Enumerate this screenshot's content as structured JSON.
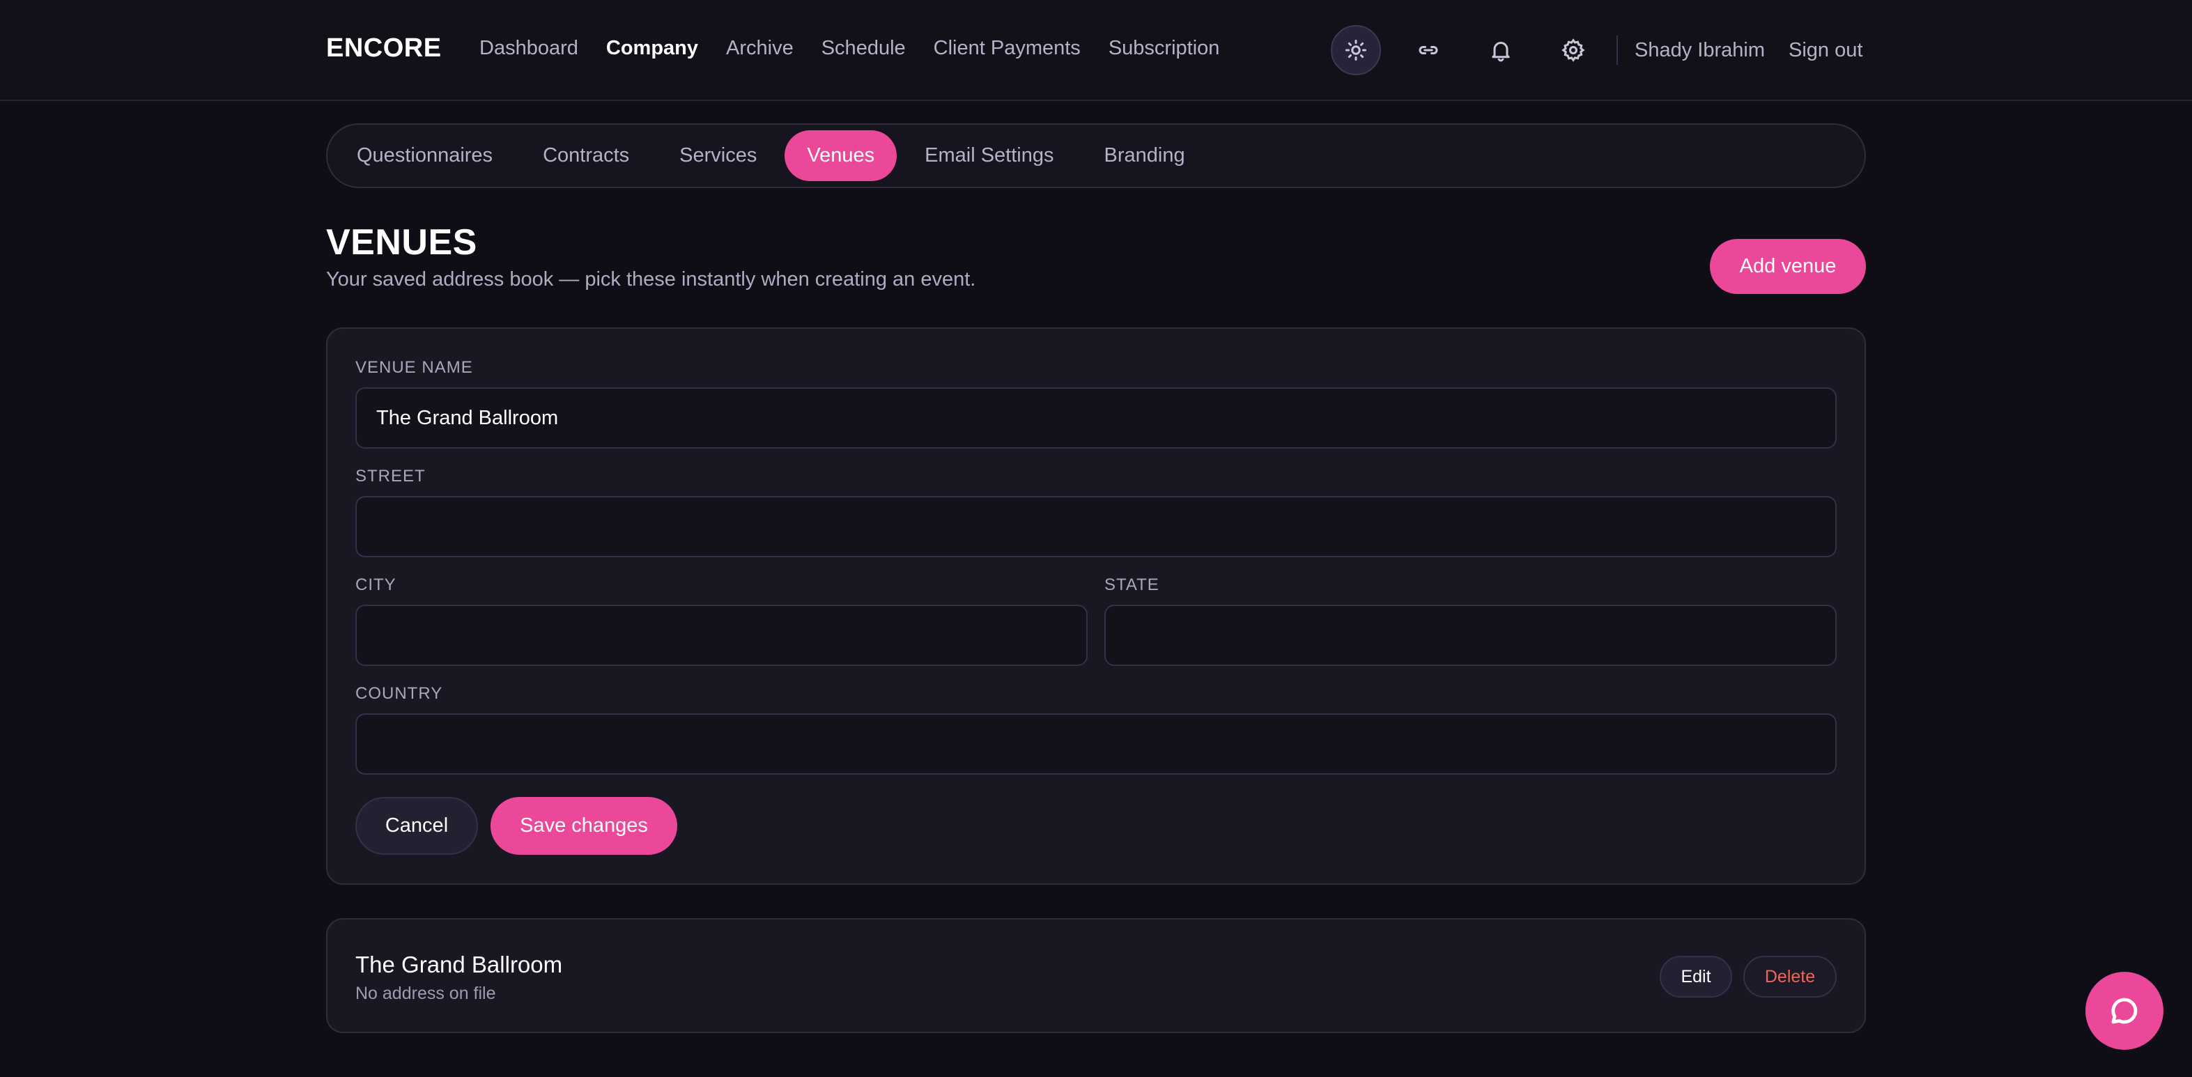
{
  "app": {
    "brand": "ENCORE"
  },
  "nav": {
    "items": [
      {
        "label": "Dashboard",
        "active": false
      },
      {
        "label": "Company",
        "active": true
      },
      {
        "label": "Archive",
        "active": false
      },
      {
        "label": "Schedule",
        "active": false
      },
      {
        "label": "Client Payments",
        "active": false
      },
      {
        "label": "Subscription",
        "active": false
      }
    ],
    "icons": [
      "sun-icon",
      "link-icon",
      "bell-icon",
      "gear-icon"
    ],
    "user_name": "Shady Ibrahim",
    "sign_out": "Sign out"
  },
  "subtabs": [
    {
      "label": "Questionnaires",
      "active": false
    },
    {
      "label": "Contracts",
      "active": false
    },
    {
      "label": "Services",
      "active": false
    },
    {
      "label": "Venues",
      "active": true
    },
    {
      "label": "Email Settings",
      "active": false
    },
    {
      "label": "Branding",
      "active": false
    }
  ],
  "page": {
    "title": "VENUES",
    "subtitle": "Your saved address book — pick these instantly when creating an event.",
    "add_button": "Add venue"
  },
  "form": {
    "venue_name": {
      "label": "VENUE NAME",
      "value": "The Grand Ballroom"
    },
    "street": {
      "label": "STREET",
      "value": ""
    },
    "city": {
      "label": "CITY",
      "value": ""
    },
    "state": {
      "label": "STATE",
      "value": ""
    },
    "country": {
      "label": "COUNTRY",
      "value": ""
    },
    "cancel": "Cancel",
    "save": "Save changes"
  },
  "venues": [
    {
      "name": "The Grand Ballroom",
      "address": "No address on file",
      "edit": "Edit",
      "delete": "Delete"
    }
  ],
  "colors": {
    "accent": "#ec4899",
    "background": "#0f0e17",
    "danger": "#f0645a"
  },
  "chat": {
    "icon": "chat-bubble-icon"
  }
}
